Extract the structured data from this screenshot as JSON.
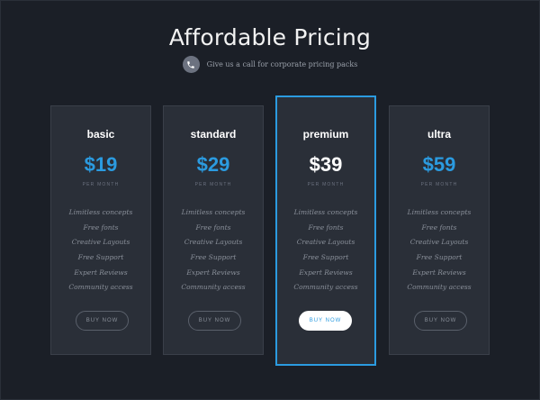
{
  "header": {
    "title": "Affordable Pricing",
    "subtitle": "Give us a call for corporate pricing packs",
    "icon": "phone-icon"
  },
  "colors": {
    "background": "#1b1f27",
    "card": "#2a2f38",
    "accent": "#2b9be0"
  },
  "plans": [
    {
      "name": "basic",
      "price": "$19",
      "period": "PER MONTH",
      "features": [
        "Limitless concepts",
        "Free fonts",
        "Creative Layouts",
        "Free Support",
        "Expert Reviews",
        "Community access"
      ],
      "button": "BUY NOW"
    },
    {
      "name": "standard",
      "price": "$29",
      "period": "PER MONTH",
      "features": [
        "Limitless concepts",
        "Free fonts",
        "Creative Layouts",
        "Free Support",
        "Expert Reviews",
        "Community access"
      ],
      "button": "BUY NOW"
    },
    {
      "name": "premium",
      "price": "$39",
      "period": "PER MONTH",
      "features": [
        "Limitless concepts",
        "Free fonts",
        "Creative Layouts",
        "Free Support",
        "Expert Reviews",
        "Community access"
      ],
      "button": "BUY NOW",
      "featured": true
    },
    {
      "name": "ultra",
      "price": "$59",
      "period": "PER MONTH",
      "features": [
        "Limitless concepts",
        "Free fonts",
        "Creative Layouts",
        "Free Support",
        "Expert Reviews",
        "Community access"
      ],
      "button": "BUY NOW"
    }
  ]
}
